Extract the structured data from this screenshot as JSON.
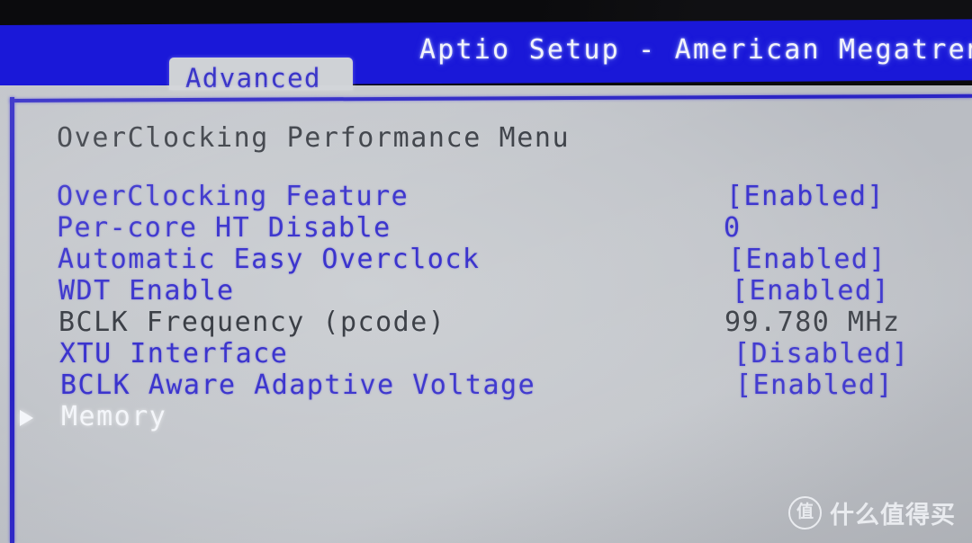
{
  "window": {
    "title": "Aptio Setup - American Megatrends",
    "title_truncated": true
  },
  "tabs": [
    {
      "label": "Advanced",
      "active": true
    }
  ],
  "content": {
    "menu_title": "OverClocking Performance Menu",
    "rows": [
      {
        "label": "OverClocking Feature",
        "value": "[Enabled]",
        "label_style": "blue",
        "value_style": "blue",
        "selected": false,
        "submenu": false
      },
      {
        "label": "Per-core HT Disable",
        "value": "0",
        "label_style": "blue",
        "value_style": "blue",
        "selected": false,
        "submenu": false
      },
      {
        "label": "Automatic Easy Overclock",
        "value": "[Enabled]",
        "label_style": "blue",
        "value_style": "blue",
        "selected": false,
        "submenu": false
      },
      {
        "label": "WDT Enable",
        "value": "[Enabled]",
        "label_style": "blue",
        "value_style": "blue",
        "selected": false,
        "submenu": false
      },
      {
        "label": "BCLK Frequency (pcode)",
        "value": "99.780 MHz",
        "label_style": "dark",
        "value_style": "dark",
        "selected": false,
        "submenu": false
      },
      {
        "label": "XTU Interface",
        "value": "[Disabled]",
        "label_style": "blue",
        "value_style": "blue",
        "selected": false,
        "submenu": false
      },
      {
        "label": "BCLK Aware Adaptive Voltage",
        "value": "[Enabled]",
        "label_style": "blue",
        "value_style": "blue",
        "selected": false,
        "submenu": false
      },
      {
        "label": "Memory",
        "value": "",
        "label_style": "white",
        "value_style": "white",
        "selected": true,
        "submenu": true
      }
    ]
  },
  "watermark": {
    "badge": "值",
    "text": "什么值得买"
  },
  "colors": {
    "title_band": "#1a18d8",
    "frame": "#2a23c4",
    "page_bg": "#c6c9cd",
    "text_blue": "#3a33cd",
    "text_dark": "#3a3e45",
    "text_white": "#f4f6fa",
    "tab_bg": "#cfd2d6"
  }
}
